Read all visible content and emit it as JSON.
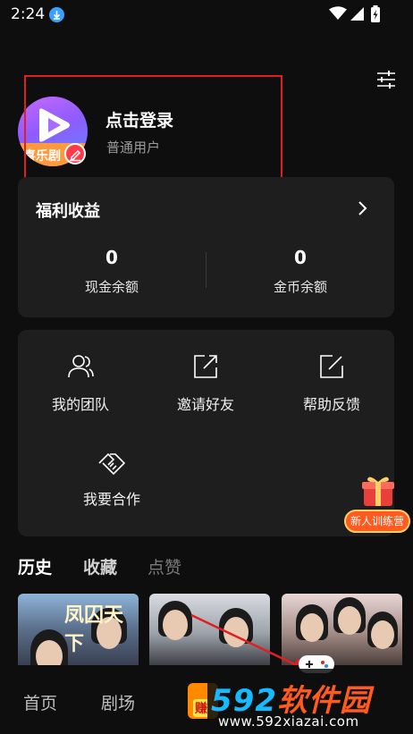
{
  "status_bar": {
    "time": "2:24",
    "icons": [
      "download-badge-icon",
      "wifi-icon",
      "signal-icon",
      "battery-charging-icon"
    ]
  },
  "header": {
    "settings_icon": "settings-sliders-icon"
  },
  "profile": {
    "login_text": "点击登录",
    "user_type": "普通用户",
    "avatar_banner_text": "喜乐剧",
    "edit_icon": "pencil-icon"
  },
  "welfare": {
    "title": "福利收益",
    "cash": {
      "value": "0",
      "label": "现金余额"
    },
    "coins": {
      "value": "0",
      "label": "金币余额"
    }
  },
  "features": [
    {
      "label": "我的团队",
      "icon": "team-icon"
    },
    {
      "label": "邀请好友",
      "icon": "share-icon"
    },
    {
      "label": "帮助反馈",
      "icon": "feedback-icon"
    },
    {
      "label": "我要合作",
      "icon": "handshake-icon"
    }
  ],
  "promo": {
    "label": "新人训练营"
  },
  "tabs": [
    "历史",
    "收藏",
    "点赞"
  ],
  "thumbnails": [
    {
      "title": "凤囚天下"
    },
    {
      "title": ""
    },
    {
      "title": ""
    }
  ],
  "bottom_nav": {
    "items": [
      "首页",
      "剧场"
    ],
    "earn_label": "赚"
  },
  "watermark": {
    "brand_num": "592",
    "brand_cn": "软件园",
    "url": "www.592xiazai.com"
  },
  "colors": {
    "background": "#0e0e0e",
    "card": "#1e1e1e",
    "highlight": "#e02020",
    "promo": "#ff5a1f",
    "watermark_blue": "#17b9ff",
    "watermark_orange": "#ff5a1f"
  }
}
